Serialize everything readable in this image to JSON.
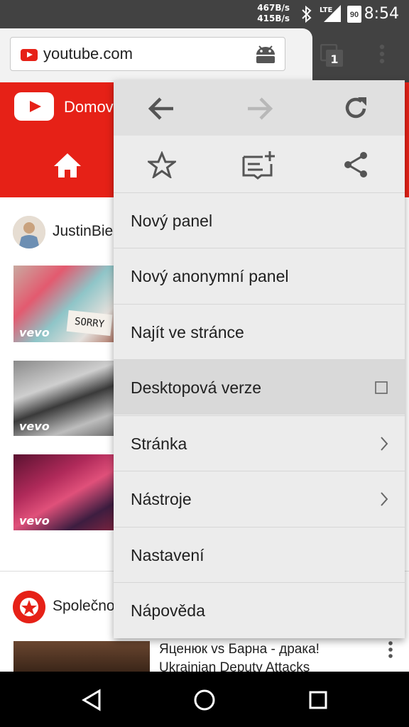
{
  "status_bar": {
    "net_down": "467B/s",
    "net_up": "415B/s",
    "network": "LTE",
    "battery": "90",
    "time": "8:54"
  },
  "toolbar": {
    "url": "youtube.com",
    "tab_count": "1"
  },
  "page": {
    "header_label": "Domov",
    "channel1_name": "JustinBie",
    "video_badge": "vevo",
    "thumb1_sign": "SORRY",
    "channel2_name": "Společno",
    "video4_title_line1": "Яценюк vs Барна - драка!",
    "video4_title_line2": "Ukrainian Deputy Attacks"
  },
  "menu": {
    "items": [
      {
        "label": "Nový panel"
      },
      {
        "label": "Nový anonymní panel"
      },
      {
        "label": "Najít ve stránce"
      },
      {
        "label": "Desktopová verze"
      },
      {
        "label": "Stránka"
      },
      {
        "label": "Nástroje"
      },
      {
        "label": "Nastavení"
      },
      {
        "label": "Nápověda"
      }
    ]
  },
  "colors": {
    "youtube_red": "#e62117",
    "status_bar": "#424242",
    "menu_bg": "#ececec",
    "menu_highlight": "#d9d9d9"
  }
}
